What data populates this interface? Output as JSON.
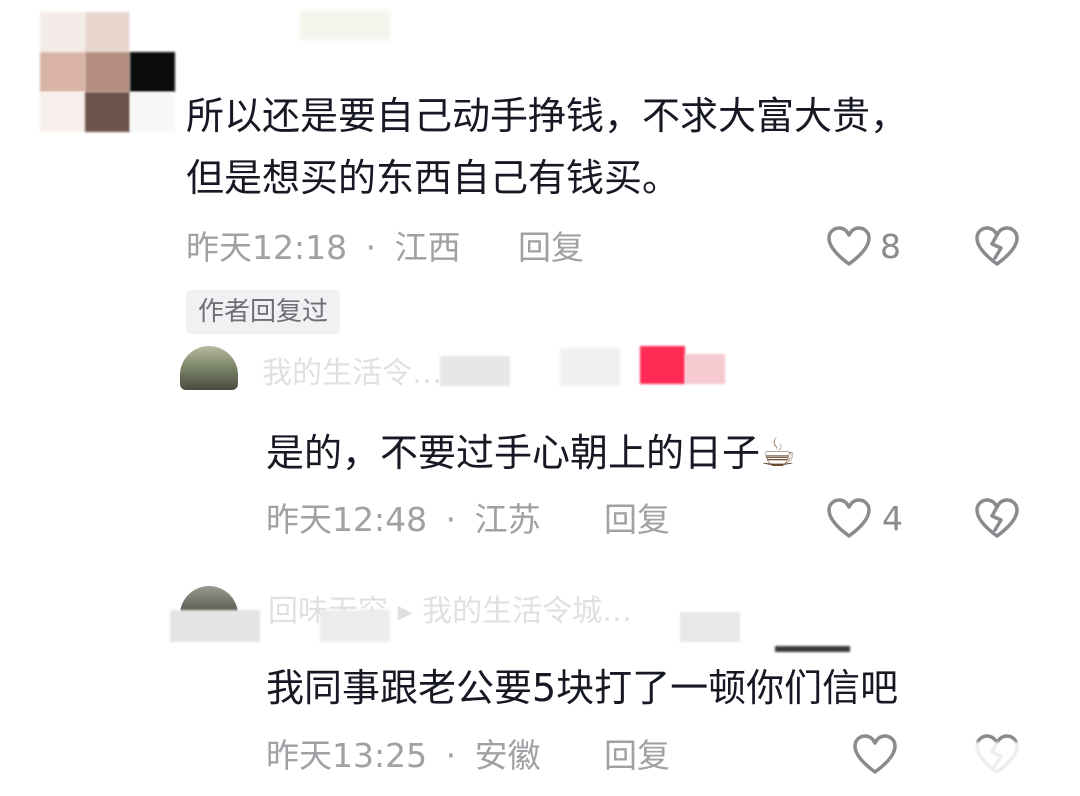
{
  "comments": [
    {
      "text_line1": "所以还是要自己动手挣钱，不求大富大贵，",
      "text_line2": "但是想买的东西自己有钱买。",
      "time": "昨天12:18",
      "separator": "·",
      "location": "江西",
      "reply_label": "回复",
      "likes": "8",
      "author_tag": "作者回复过"
    },
    {
      "username": "我的生活令…",
      "text": "是的，不要过手心朝上的日子",
      "emoji": "☕",
      "time": "昨天12:48",
      "separator": "·",
      "location": "江苏",
      "reply_label": "回复",
      "likes": "4"
    },
    {
      "username": "回味无穷 ▸ 我的生活令城…",
      "text": "我同事跟老公要5块打了一顿你们信吧",
      "time": "昨天13:25",
      "separator": "·",
      "location": "安徽",
      "reply_label": "回复"
    }
  ],
  "colors": {
    "text": "#161823",
    "meta": "#a0a0a5",
    "tag_bg": "#f1f1f3",
    "pink_pixel": "#fe2c55"
  },
  "icons": [
    "heart-icon",
    "broken-heart-icon"
  ]
}
